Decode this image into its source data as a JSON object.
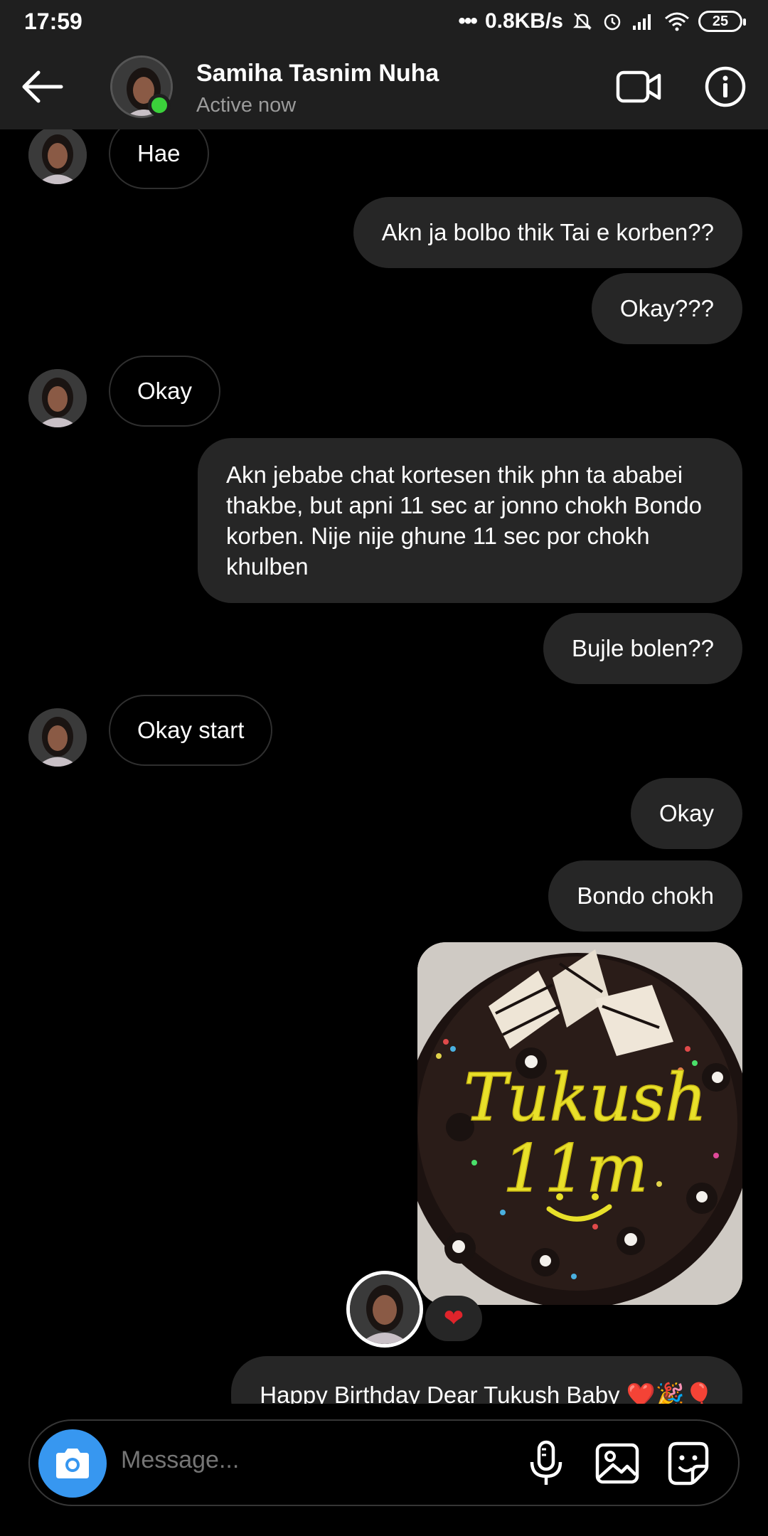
{
  "status_bar": {
    "time": "17:59",
    "network_speed": "0.8KB/s",
    "battery": "25"
  },
  "header": {
    "contact_name": "Samiha Tasnim Nuha",
    "status": "Active now"
  },
  "messages": [
    {
      "from": "them",
      "text": "Hae"
    },
    {
      "from": "me",
      "text": "Akn ja bolbo thik Tai e korben??"
    },
    {
      "from": "me",
      "text": "Okay???"
    },
    {
      "from": "them",
      "text": "Okay"
    },
    {
      "from": "me",
      "text": "Akn jebabe chat kortesen thik phn ta ababei thakbe, but apni 11 sec ar jonno chokh Bondo korben. Nije nije ghune 11 sec por chokh khulben"
    },
    {
      "from": "me",
      "text": "Bujle bolen??"
    },
    {
      "from": "them",
      "text": "Okay start"
    },
    {
      "from": "me",
      "text": "Okay"
    },
    {
      "from": "me",
      "text": "Bondo chokh"
    },
    {
      "from": "me",
      "type": "photo",
      "photo_text_line1": "Tukush",
      "photo_text_line2": "11m"
    },
    {
      "from": "me",
      "text": "Happy Birthday Dear Tukush Baby ❤️🎉🎈"
    }
  ],
  "reaction": "❤",
  "composer": {
    "placeholder": "Message..."
  }
}
